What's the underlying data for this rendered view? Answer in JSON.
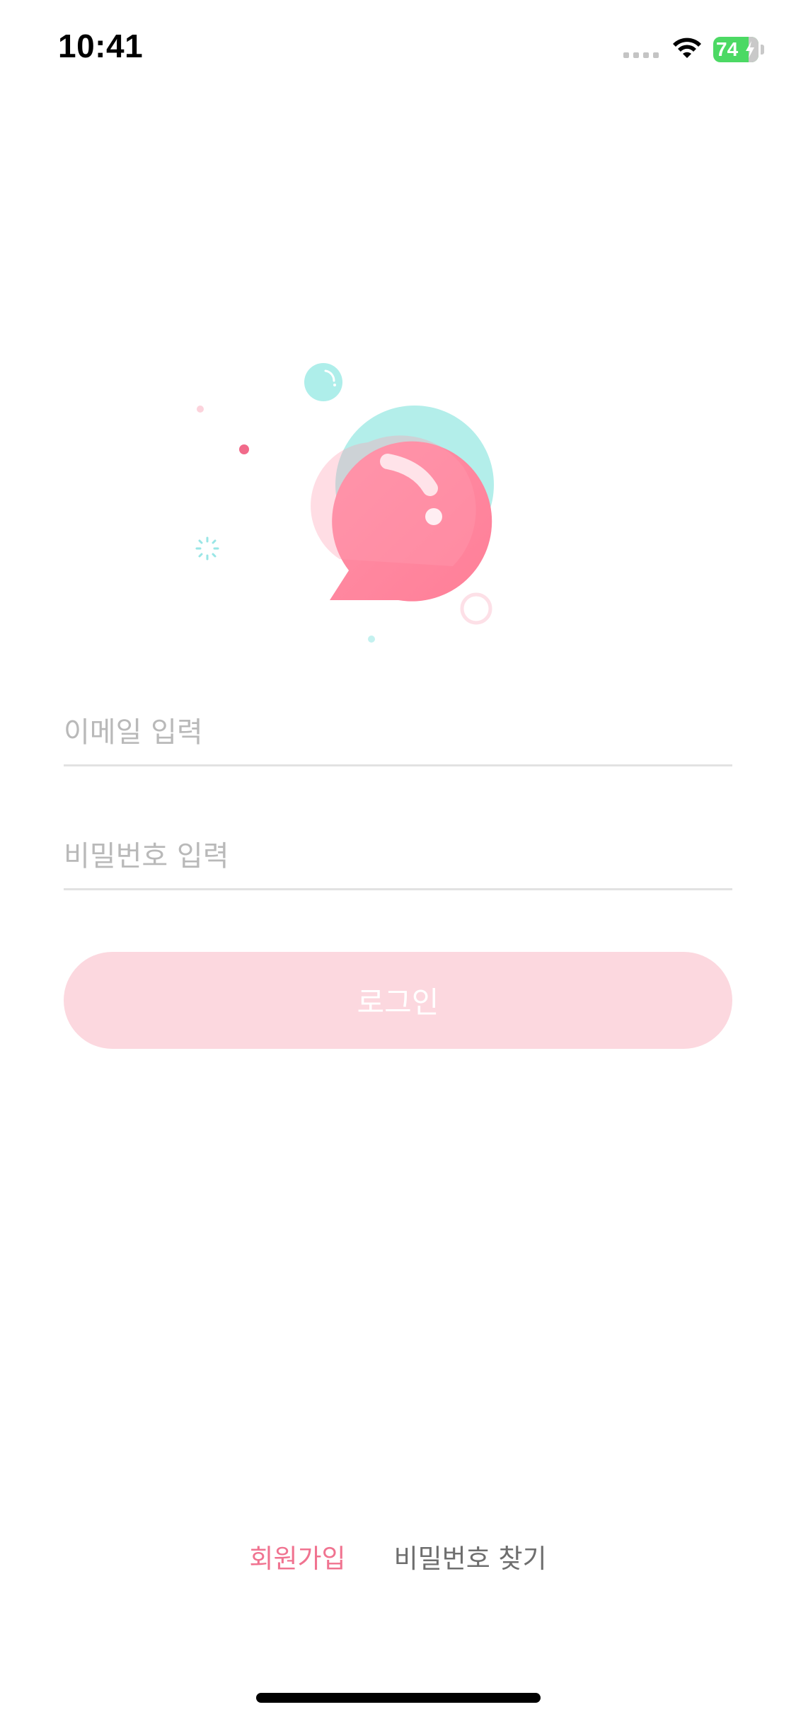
{
  "status_bar": {
    "time": "10:41",
    "battery_percent": "74",
    "icons": [
      "signal-dots-icon",
      "wifi-icon",
      "battery-charging-icon"
    ]
  },
  "illustration": {
    "icon": "chat-bubbles-icon",
    "colors": {
      "pink_bubble": "#ff7f98",
      "mint_bubble": "#aeeeea",
      "accent_pink": "#f16a8a",
      "accent_mint": "#99e6e6"
    }
  },
  "login_form": {
    "email_placeholder": "이메일 입력",
    "email_value": "",
    "password_placeholder": "비밀번호 입력",
    "password_value": "",
    "login_label": "로그인"
  },
  "footer_links": {
    "signup_label": "회원가입",
    "find_password_label": "비밀번호 찾기"
  },
  "colors": {
    "button_disabled_bg": "#fcd8df",
    "signup_link": "#f07390",
    "secondary_link": "#6e6e6e",
    "input_underline": "#e2e2e2",
    "placeholder": "#b9b9b9"
  }
}
